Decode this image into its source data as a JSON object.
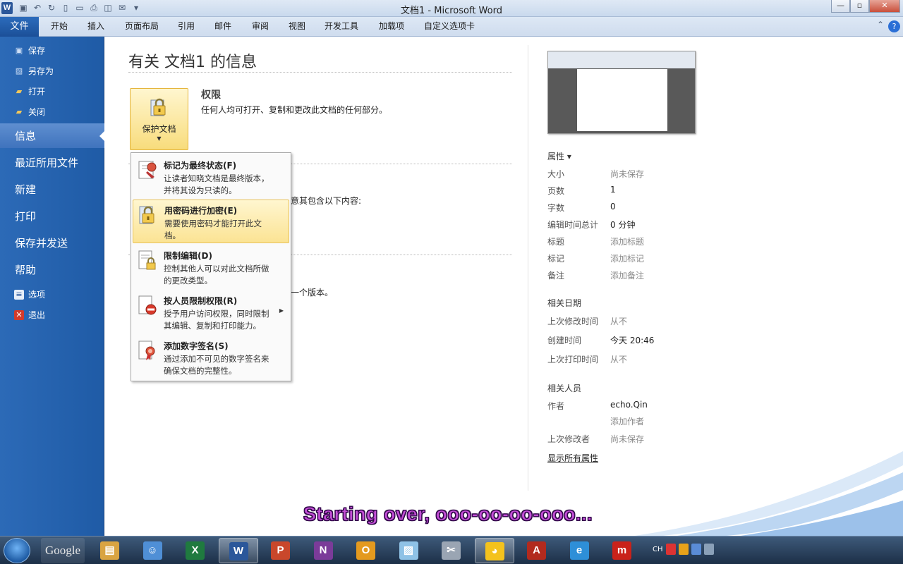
{
  "window": {
    "title": "文档1 - Microsoft Word",
    "controls": [
      "—",
      "▫",
      "✕"
    ]
  },
  "ribbon": {
    "file_tab": "文件",
    "tabs": [
      "开始",
      "插入",
      "页面布局",
      "引用",
      "邮件",
      "审阅",
      "视图",
      "开发工具",
      "加载项",
      "自定义选项卡"
    ]
  },
  "nav": {
    "commands": [
      {
        "label": "保存",
        "icon": "save-icon"
      },
      {
        "label": "另存为",
        "icon": "save-as-icon"
      },
      {
        "label": "打开",
        "icon": "open-folder-icon"
      },
      {
        "label": "关闭",
        "icon": "close-folder-icon"
      }
    ],
    "tabs": [
      "信息",
      "最近所用文件",
      "新建",
      "打印",
      "保存并发送",
      "帮助"
    ],
    "selected": "信息",
    "bottom": [
      {
        "label": "选项",
        "icon": "options-icon"
      },
      {
        "label": "退出",
        "icon": "exit-icon"
      }
    ]
  },
  "info": {
    "title": "有关 文档1 的信息",
    "protect_button": "保护文档",
    "permissions_heading": "权限",
    "permissions_desc": "任何人均可打开、复制和更改此文档的任何部分。",
    "partial_text_1": "意其包含以下内容:",
    "partial_text_2": "一个版本。"
  },
  "protect_menu": [
    {
      "title": "标记为最终状态(F)",
      "desc": "让读者知晓文档是最终版本，并将其设为只读的。",
      "icon": "mark-final-icon",
      "highlighted": false
    },
    {
      "title": "用密码进行加密(E)",
      "desc": "需要使用密码才能打开此文档。",
      "icon": "encrypt-lock-icon",
      "highlighted": true
    },
    {
      "title": "限制编辑(D)",
      "desc": "控制其他人可以对此文档所做的更改类型。",
      "icon": "restrict-editing-icon",
      "highlighted": false
    },
    {
      "title": "按人员限制权限(R)",
      "desc": "授予用户访问权限，同时限制其编辑、复制和打印能力。",
      "icon": "restrict-permission-icon",
      "highlighted": false,
      "submenu": true
    },
    {
      "title": "添加数字签名(S)",
      "desc": "通过添加不可见的数字签名来确保文档的完整性。",
      "icon": "digital-signature-icon",
      "highlighted": false
    }
  ],
  "properties": {
    "heading": "属性 ▾",
    "rows": [
      {
        "label": "大小",
        "value": "尚未保存",
        "muted": true
      },
      {
        "label": "页数",
        "value": "1",
        "muted": false
      },
      {
        "label": "字数",
        "value": "0",
        "muted": false
      },
      {
        "label": "编辑时间总计",
        "value": "0 分钟",
        "muted": false
      },
      {
        "label": "标题",
        "value": "添加标题",
        "muted": true
      },
      {
        "label": "标记",
        "value": "添加标记",
        "muted": true
      },
      {
        "label": "备注",
        "value": "添加备注",
        "muted": true
      }
    ],
    "dates_heading": "相关日期",
    "dates": [
      {
        "label": "上次修改时间",
        "value": "从不",
        "muted": true
      },
      {
        "label": "创建时间",
        "value": "今天 20:46",
        "muted": false
      },
      {
        "label": "上次打印时间",
        "value": "从不",
        "muted": true
      }
    ],
    "people_heading": "相关人员",
    "author_label": "作者",
    "author_value": "echo.Qin",
    "add_author": "添加作者",
    "last_modified_by_label": "上次修改者",
    "last_modified_by_value": "尚未保存",
    "show_all": "显示所有属性"
  },
  "subtitle": "Starting over, ooo-oo-oo-ooo...",
  "taskbar": {
    "google": "Google",
    "apps": [
      {
        "name": "explorer",
        "color": "#d9a441",
        "glyph": "▤"
      },
      {
        "name": "contacts",
        "color": "#4f8fd6",
        "glyph": "☺"
      },
      {
        "name": "excel",
        "color": "#1f7a3f",
        "glyph": "X"
      },
      {
        "name": "word",
        "color": "#2b579a",
        "glyph": "W",
        "active": true
      },
      {
        "name": "powerpoint",
        "color": "#c9472b",
        "glyph": "P"
      },
      {
        "name": "onenote",
        "color": "#7b3b99",
        "glyph": "N"
      },
      {
        "name": "outlook",
        "color": "#e49a1f",
        "glyph": "O"
      },
      {
        "name": "notes",
        "color": "#8fc2e6",
        "glyph": "▨"
      },
      {
        "name": "snipping",
        "color": "#9aa5b3",
        "glyph": "✂"
      },
      {
        "name": "qq",
        "color": "#f4c21d",
        "glyph": "◕",
        "active": true
      },
      {
        "name": "acrobat",
        "color": "#b22a1e",
        "glyph": "A"
      },
      {
        "name": "ie",
        "color": "#2e8fd8",
        "glyph": "e"
      },
      {
        "name": "m-app",
        "color": "#c9221a",
        "glyph": "m"
      }
    ],
    "tray_text": "CH"
  }
}
